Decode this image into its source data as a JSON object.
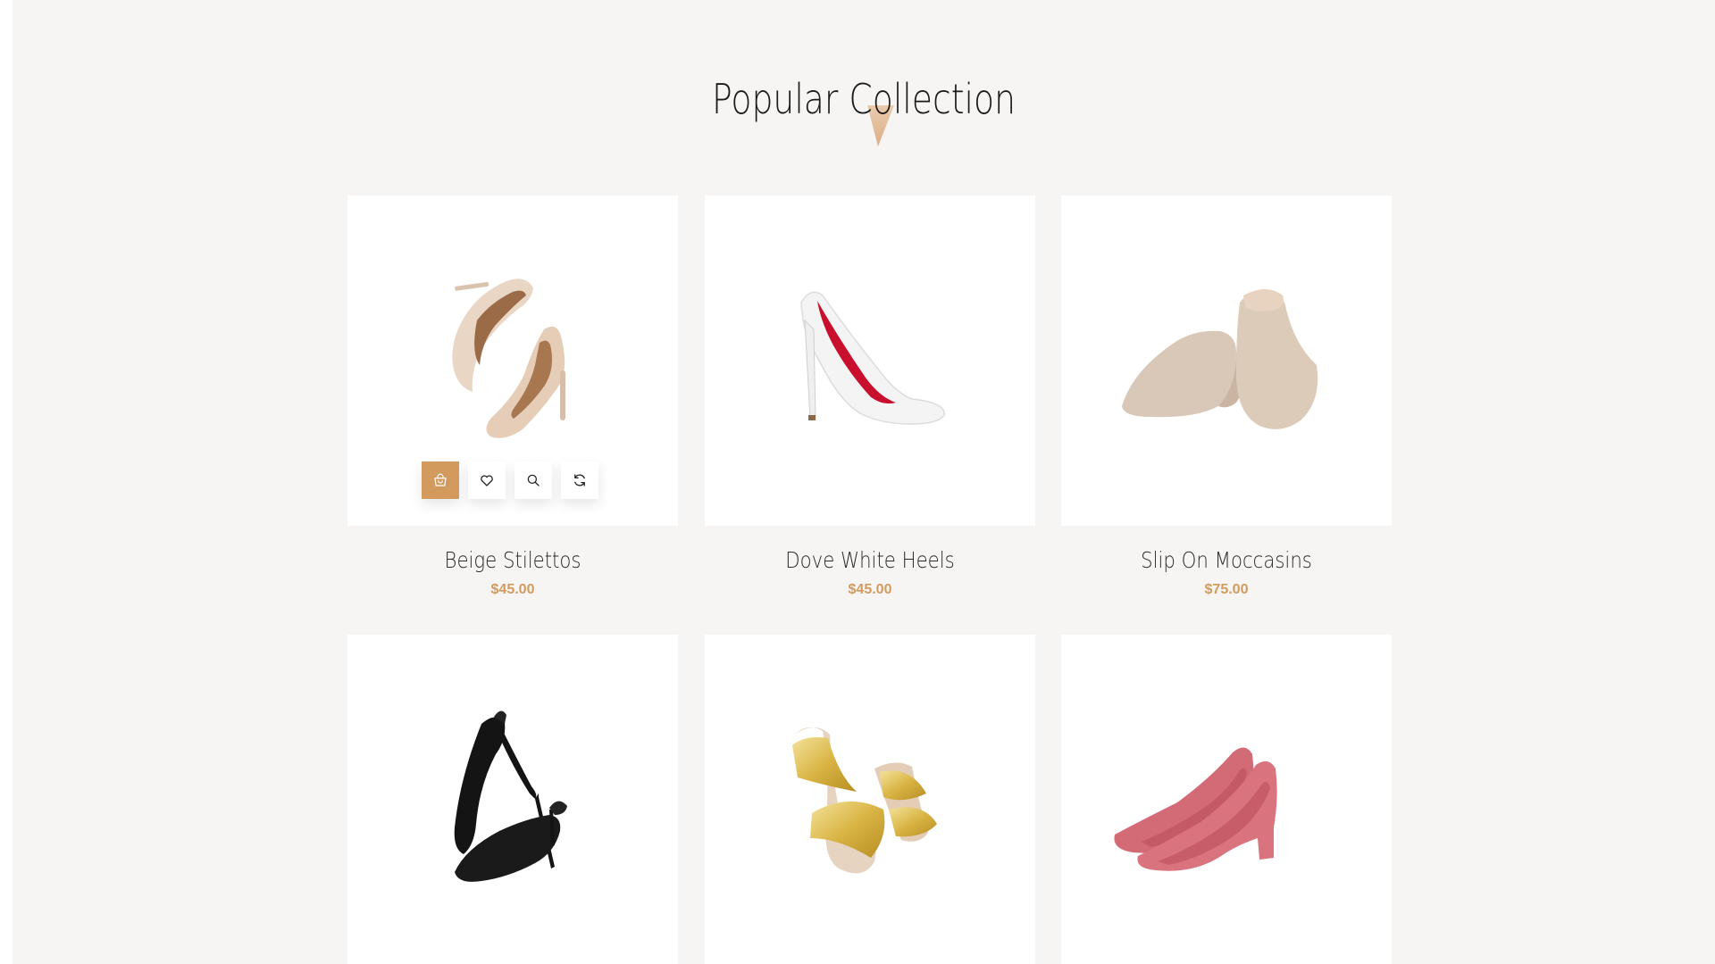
{
  "section": {
    "title": "Popular Collection"
  },
  "colors": {
    "accent": "#d29b5d",
    "background": "#f6f5f3",
    "card": "#ffffff"
  },
  "actions": [
    {
      "icon": "shopping-bag-icon"
    },
    {
      "icon": "heart-icon"
    },
    {
      "icon": "search-icon"
    },
    {
      "icon": "refresh-icon"
    }
  ],
  "products": [
    {
      "name": "Beige Stilettos",
      "price": "$45.00"
    },
    {
      "name": "Dove White Heels",
      "price": "$45.00"
    },
    {
      "name": "Slip On Moccasins",
      "price": "$75.00"
    },
    {
      "name": "",
      "price": ""
    },
    {
      "name": "",
      "price": ""
    },
    {
      "name": "",
      "price": ""
    }
  ]
}
